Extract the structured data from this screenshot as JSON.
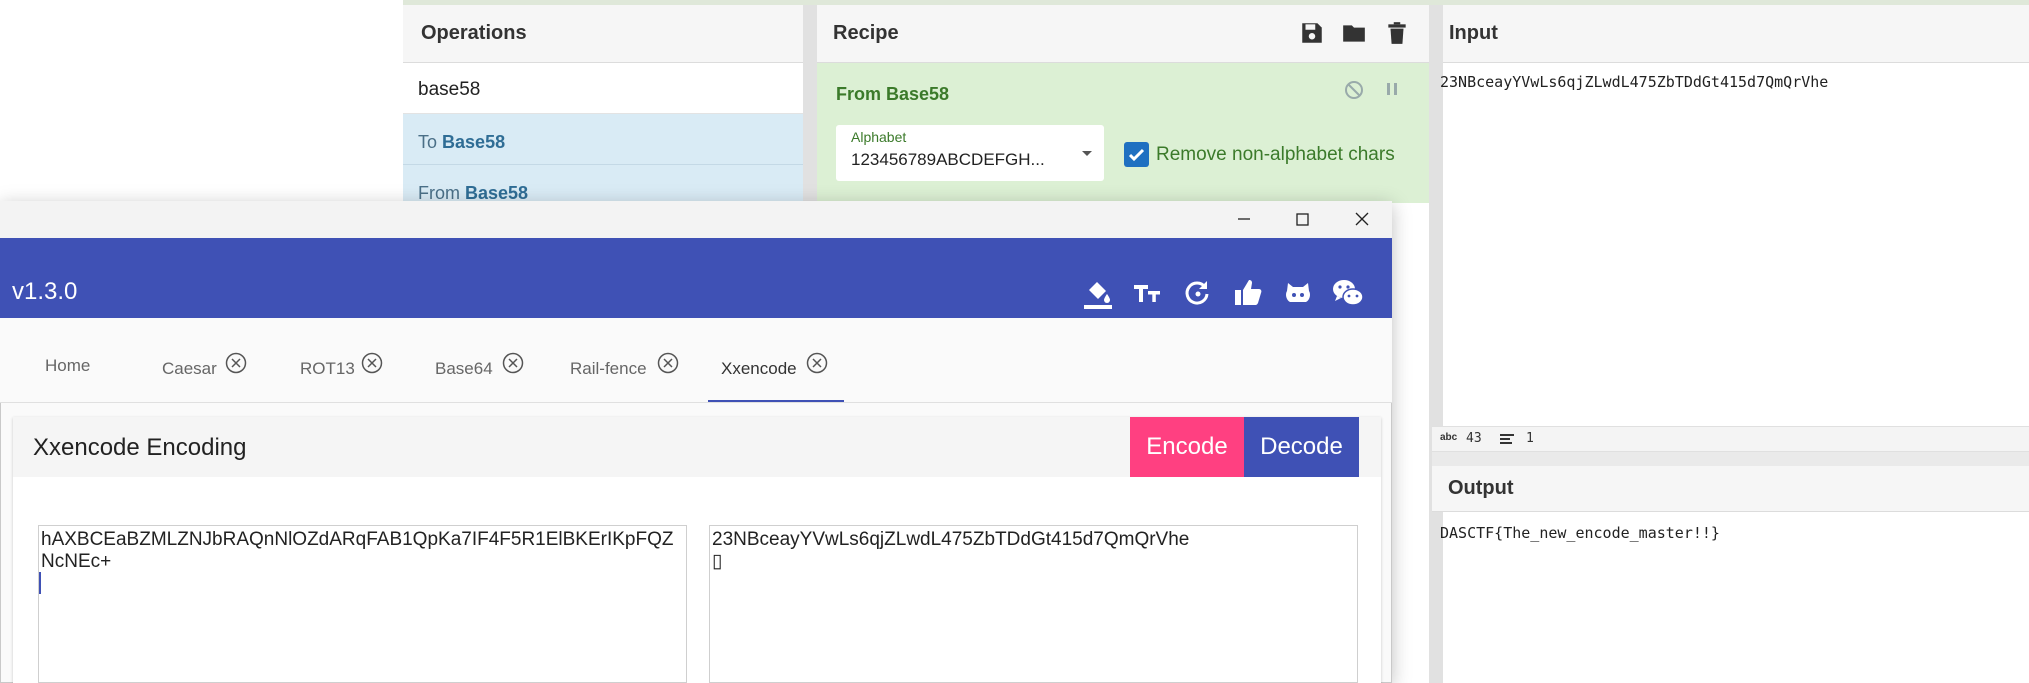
{
  "cyberchef": {
    "operations": {
      "title": "Operations",
      "search_value": "base58",
      "items": [
        {
          "prefix": "To",
          "name": "Base58"
        },
        {
          "prefix": "From",
          "name": "Base58"
        }
      ]
    },
    "recipe": {
      "title": "Recipe",
      "icons": [
        "save-icon",
        "folder-icon",
        "trash-icon"
      ],
      "operation": {
        "name": "From Base58",
        "alphabet_label": "Alphabet",
        "alphabet_value": "123456789ABCDEFGH...",
        "remove_non_alphabet_label": "Remove non-alphabet chars",
        "remove_non_alphabet_checked": true
      }
    },
    "input": {
      "title": "Input",
      "text": "23NBceayYVwLs6qjZLwdL475ZbTDdGt415d7QmQrVhe",
      "status_length": "43",
      "status_lines": "1"
    },
    "output": {
      "title": "Output",
      "text": "DASCTF{The_new_encode_master!!}"
    },
    "colors": {
      "recipe_bg": "#dcf0d4",
      "ops_highlight": "#d9ebf5",
      "green_text": "#3b7a2a"
    }
  },
  "tool": {
    "version": "v1.3.0",
    "appbar_icons": [
      "paint-bucket-icon",
      "text-size-icon",
      "refresh-icon",
      "thumbs-up-icon",
      "github-icon",
      "wechat-icon"
    ],
    "tabs": [
      {
        "label": "Home",
        "closable": false
      },
      {
        "label": "Caesar",
        "closable": true
      },
      {
        "label": "ROT13",
        "closable": true
      },
      {
        "label": "Base64",
        "closable": true
      },
      {
        "label": "Rail-fence",
        "closable": true
      },
      {
        "label": "Xxencode",
        "closable": true,
        "active": true
      }
    ],
    "card_title": "Xxencode Encoding",
    "encode_label": "Encode",
    "decode_label": "Decode",
    "left_text": "hAXBCEaBZMLZNJbRAQnNlOZdARqFAB1QpKa7IF4F5R1ElBKErIKpFQZNcNEc+",
    "right_text": "23NBceayYVwLs6qjZLwdL475ZbTDdGt415d7QmQrVhe\n▯",
    "colors": {
      "primary": "#3f51b5",
      "accent": "#ff4081"
    }
  }
}
